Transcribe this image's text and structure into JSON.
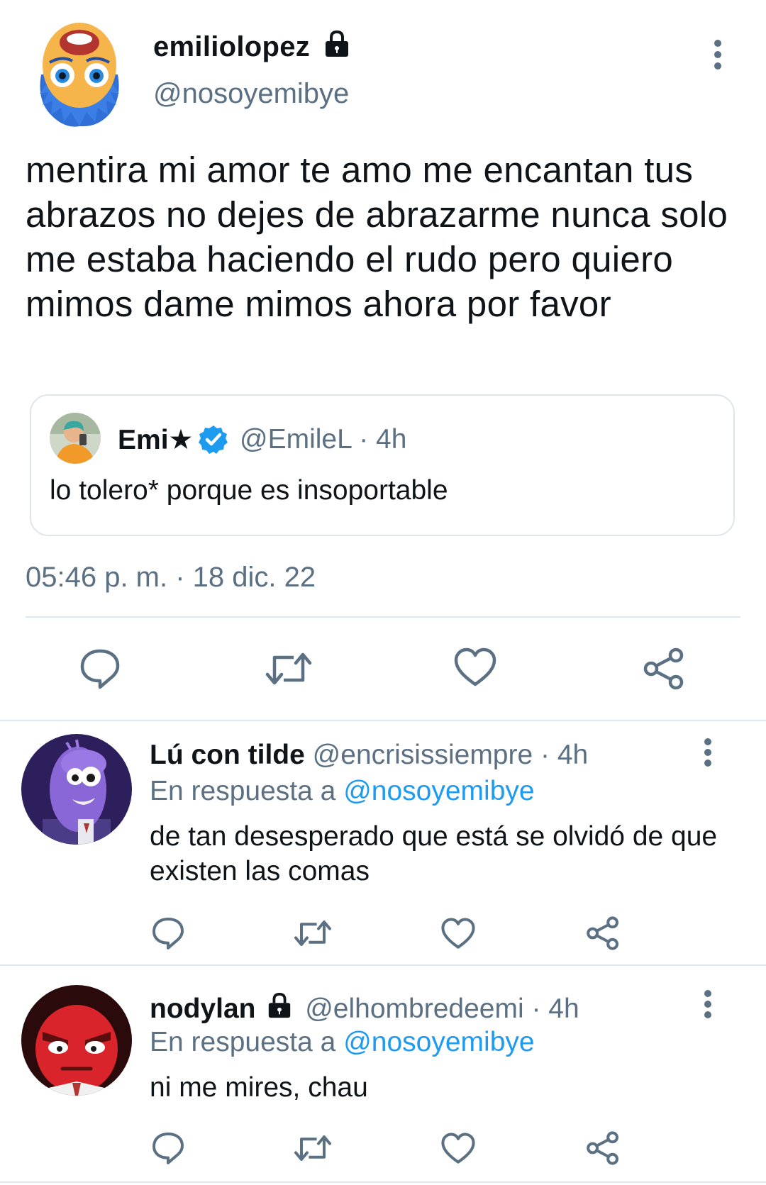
{
  "main_tweet": {
    "display_name": "emiliolopez",
    "handle": "@nosoyemibye",
    "text": "mentira mi amor te amo me encantan tus abrazos no dejes de abrazarme nunca solo me estaba haciendo el rudo pero quiero mimos dame mimos ahora por favor",
    "timestamp": "05:46 p. m. · 18 dic. 22",
    "quoted": {
      "display_name": "Emi★",
      "handle_time": "@EmileL · 4h",
      "text": "lo tolero* porque es insoportable"
    }
  },
  "replies": [
    {
      "display_name": "Lú con tilde",
      "handle_time": "@encrisissiempre · 4h",
      "reply_prefix": "En respuesta a",
      "reply_handle": "@nosoyemibye",
      "text": "de tan desesperado que está se olvidó de que existen las comas"
    },
    {
      "display_name": "nodylan",
      "handle_time": "@elhombredeemi · 4h",
      "reply_prefix": "En respuesta a",
      "reply_handle": "@nosoyemibye",
      "text": "ni me mires, chau"
    }
  ],
  "colors": {
    "text": "#0f1419",
    "secondary": "#5b7083",
    "accent": "#1d9bf0",
    "divider": "#e1e8ed"
  },
  "icons": [
    "lock-icon",
    "more-icon",
    "verified-icon",
    "reply-icon",
    "retweet-icon",
    "like-icon",
    "share-icon"
  ]
}
